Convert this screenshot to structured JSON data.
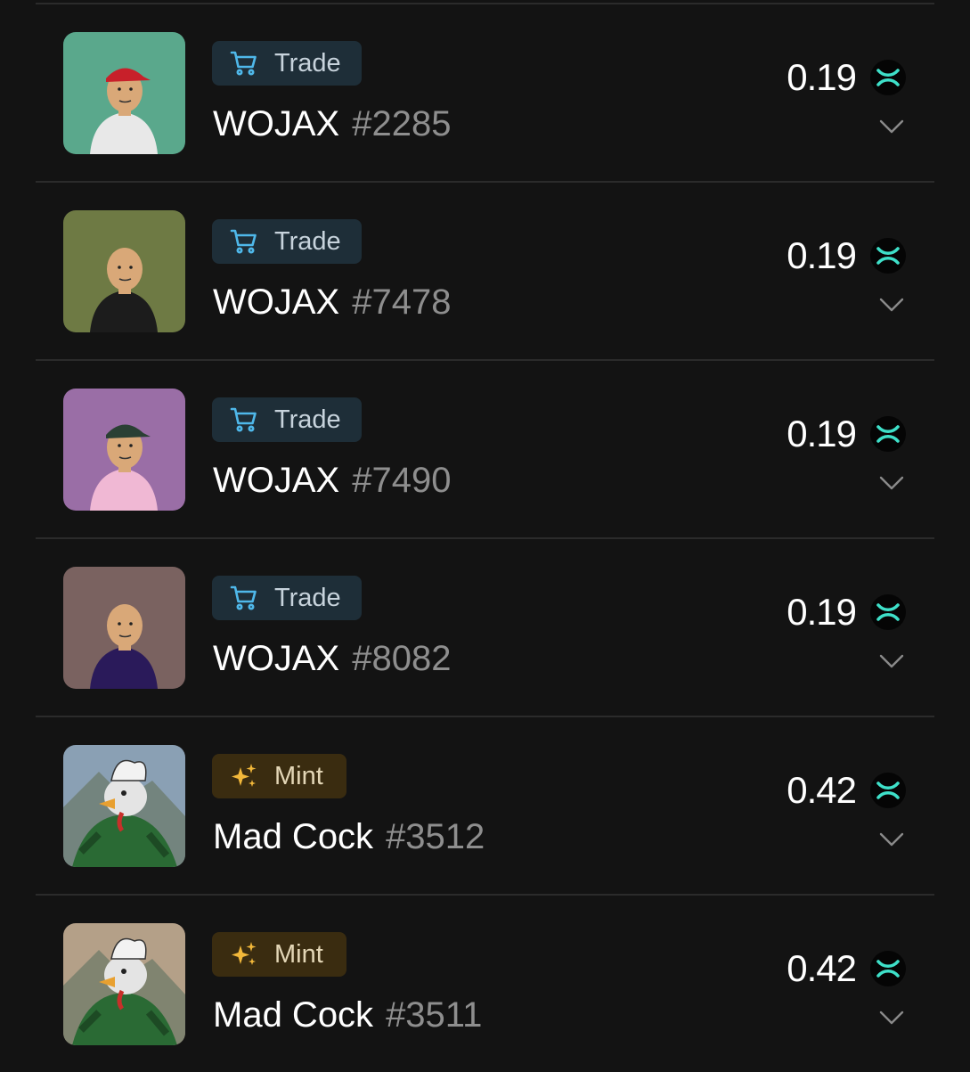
{
  "colors": {
    "background": "#131313",
    "divider": "#2b2b2b",
    "trade_badge_bg": "#1e2e38",
    "trade_icon": "#4fb8ea",
    "mint_badge_bg": "#3a2c10",
    "mint_icon": "#f2b83a",
    "coin_accent": "#3ee0c9"
  },
  "items": [
    {
      "badge": "Trade",
      "badge_icon": "cart-icon",
      "name": "WOJAX",
      "number": "#2285",
      "price": "0.19",
      "coin_icon": "xrp-icon",
      "thumb_bg": "#5aa88c",
      "shirt": "#e8e8e8",
      "cap": "#c8202a"
    },
    {
      "badge": "Trade",
      "badge_icon": "cart-icon",
      "name": "WOJAX",
      "number": "#7478",
      "price": "0.19",
      "coin_icon": "xrp-icon",
      "thumb_bg": "#6e7a44",
      "shirt": "#1c1c1c",
      "cap": ""
    },
    {
      "badge": "Trade",
      "badge_icon": "cart-icon",
      "name": "WOJAX",
      "number": "#7490",
      "price": "0.19",
      "coin_icon": "xrp-icon",
      "thumb_bg": "#9a6ea6",
      "shirt": "#f0b8d4",
      "cap": "#2a4034"
    },
    {
      "badge": "Trade",
      "badge_icon": "cart-icon",
      "name": "WOJAX",
      "number": "#8082",
      "price": "0.19",
      "coin_icon": "xrp-icon",
      "thumb_bg": "#7a6260",
      "shirt": "#2a1a5a",
      "cap": ""
    },
    {
      "badge": "Mint",
      "badge_icon": "sparkle-icon",
      "name": "Mad Cock",
      "number": "#3512",
      "price": "0.42",
      "coin_icon": "xrp-icon",
      "thumb_bg": "#8aa0b4",
      "shirt": "#2a6a34",
      "cap": ""
    },
    {
      "badge": "Mint",
      "badge_icon": "sparkle-icon",
      "name": "Mad Cock",
      "number": "#3511",
      "price": "0.42",
      "coin_icon": "xrp-icon",
      "thumb_bg": "#b4a088",
      "shirt": "#2a6a34",
      "cap": ""
    }
  ]
}
